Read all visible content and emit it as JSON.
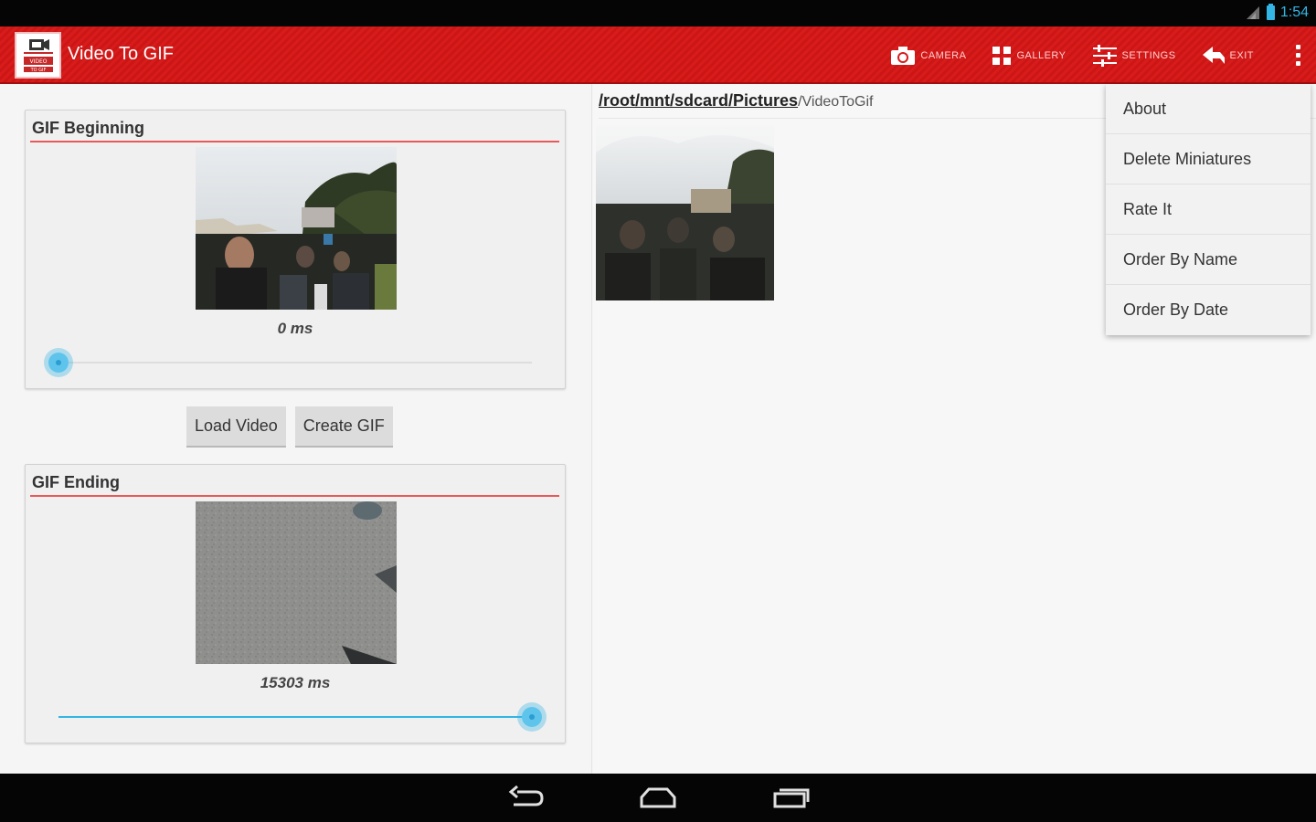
{
  "status_bar": {
    "time": "1:54"
  },
  "app": {
    "title": "Video To GIF",
    "logo_text": "VIDEO TO GIF"
  },
  "actions": [
    {
      "label": "CAMERA",
      "icon": "camera-icon"
    },
    {
      "label": "GALLERY",
      "icon": "gallery-grid-icon"
    },
    {
      "label": "SETTINGS",
      "icon": "settings-sliders-icon"
    },
    {
      "label": "EXIT",
      "icon": "exit-arrow-icon"
    }
  ],
  "begin": {
    "title": "GIF Beginning",
    "time_label": "0 ms",
    "slider_fraction": 0.0
  },
  "end": {
    "title": "GIF Ending",
    "time_label": "15303 ms",
    "slider_fraction": 1.0
  },
  "buttons": {
    "load": "Load Video",
    "create": "Create GIF"
  },
  "browser": {
    "path_link": "/root/mnt/sdcard/Pictures",
    "path_tail": "/VideoToGif"
  },
  "menu": {
    "items": [
      "About",
      "Delete Miniatures",
      "Rate It",
      "Order By Name",
      "Order By Date"
    ]
  },
  "colors": {
    "action_bar": "#d81b1b",
    "accent": "#33b5e5",
    "card_rule": "#e85a5a"
  }
}
